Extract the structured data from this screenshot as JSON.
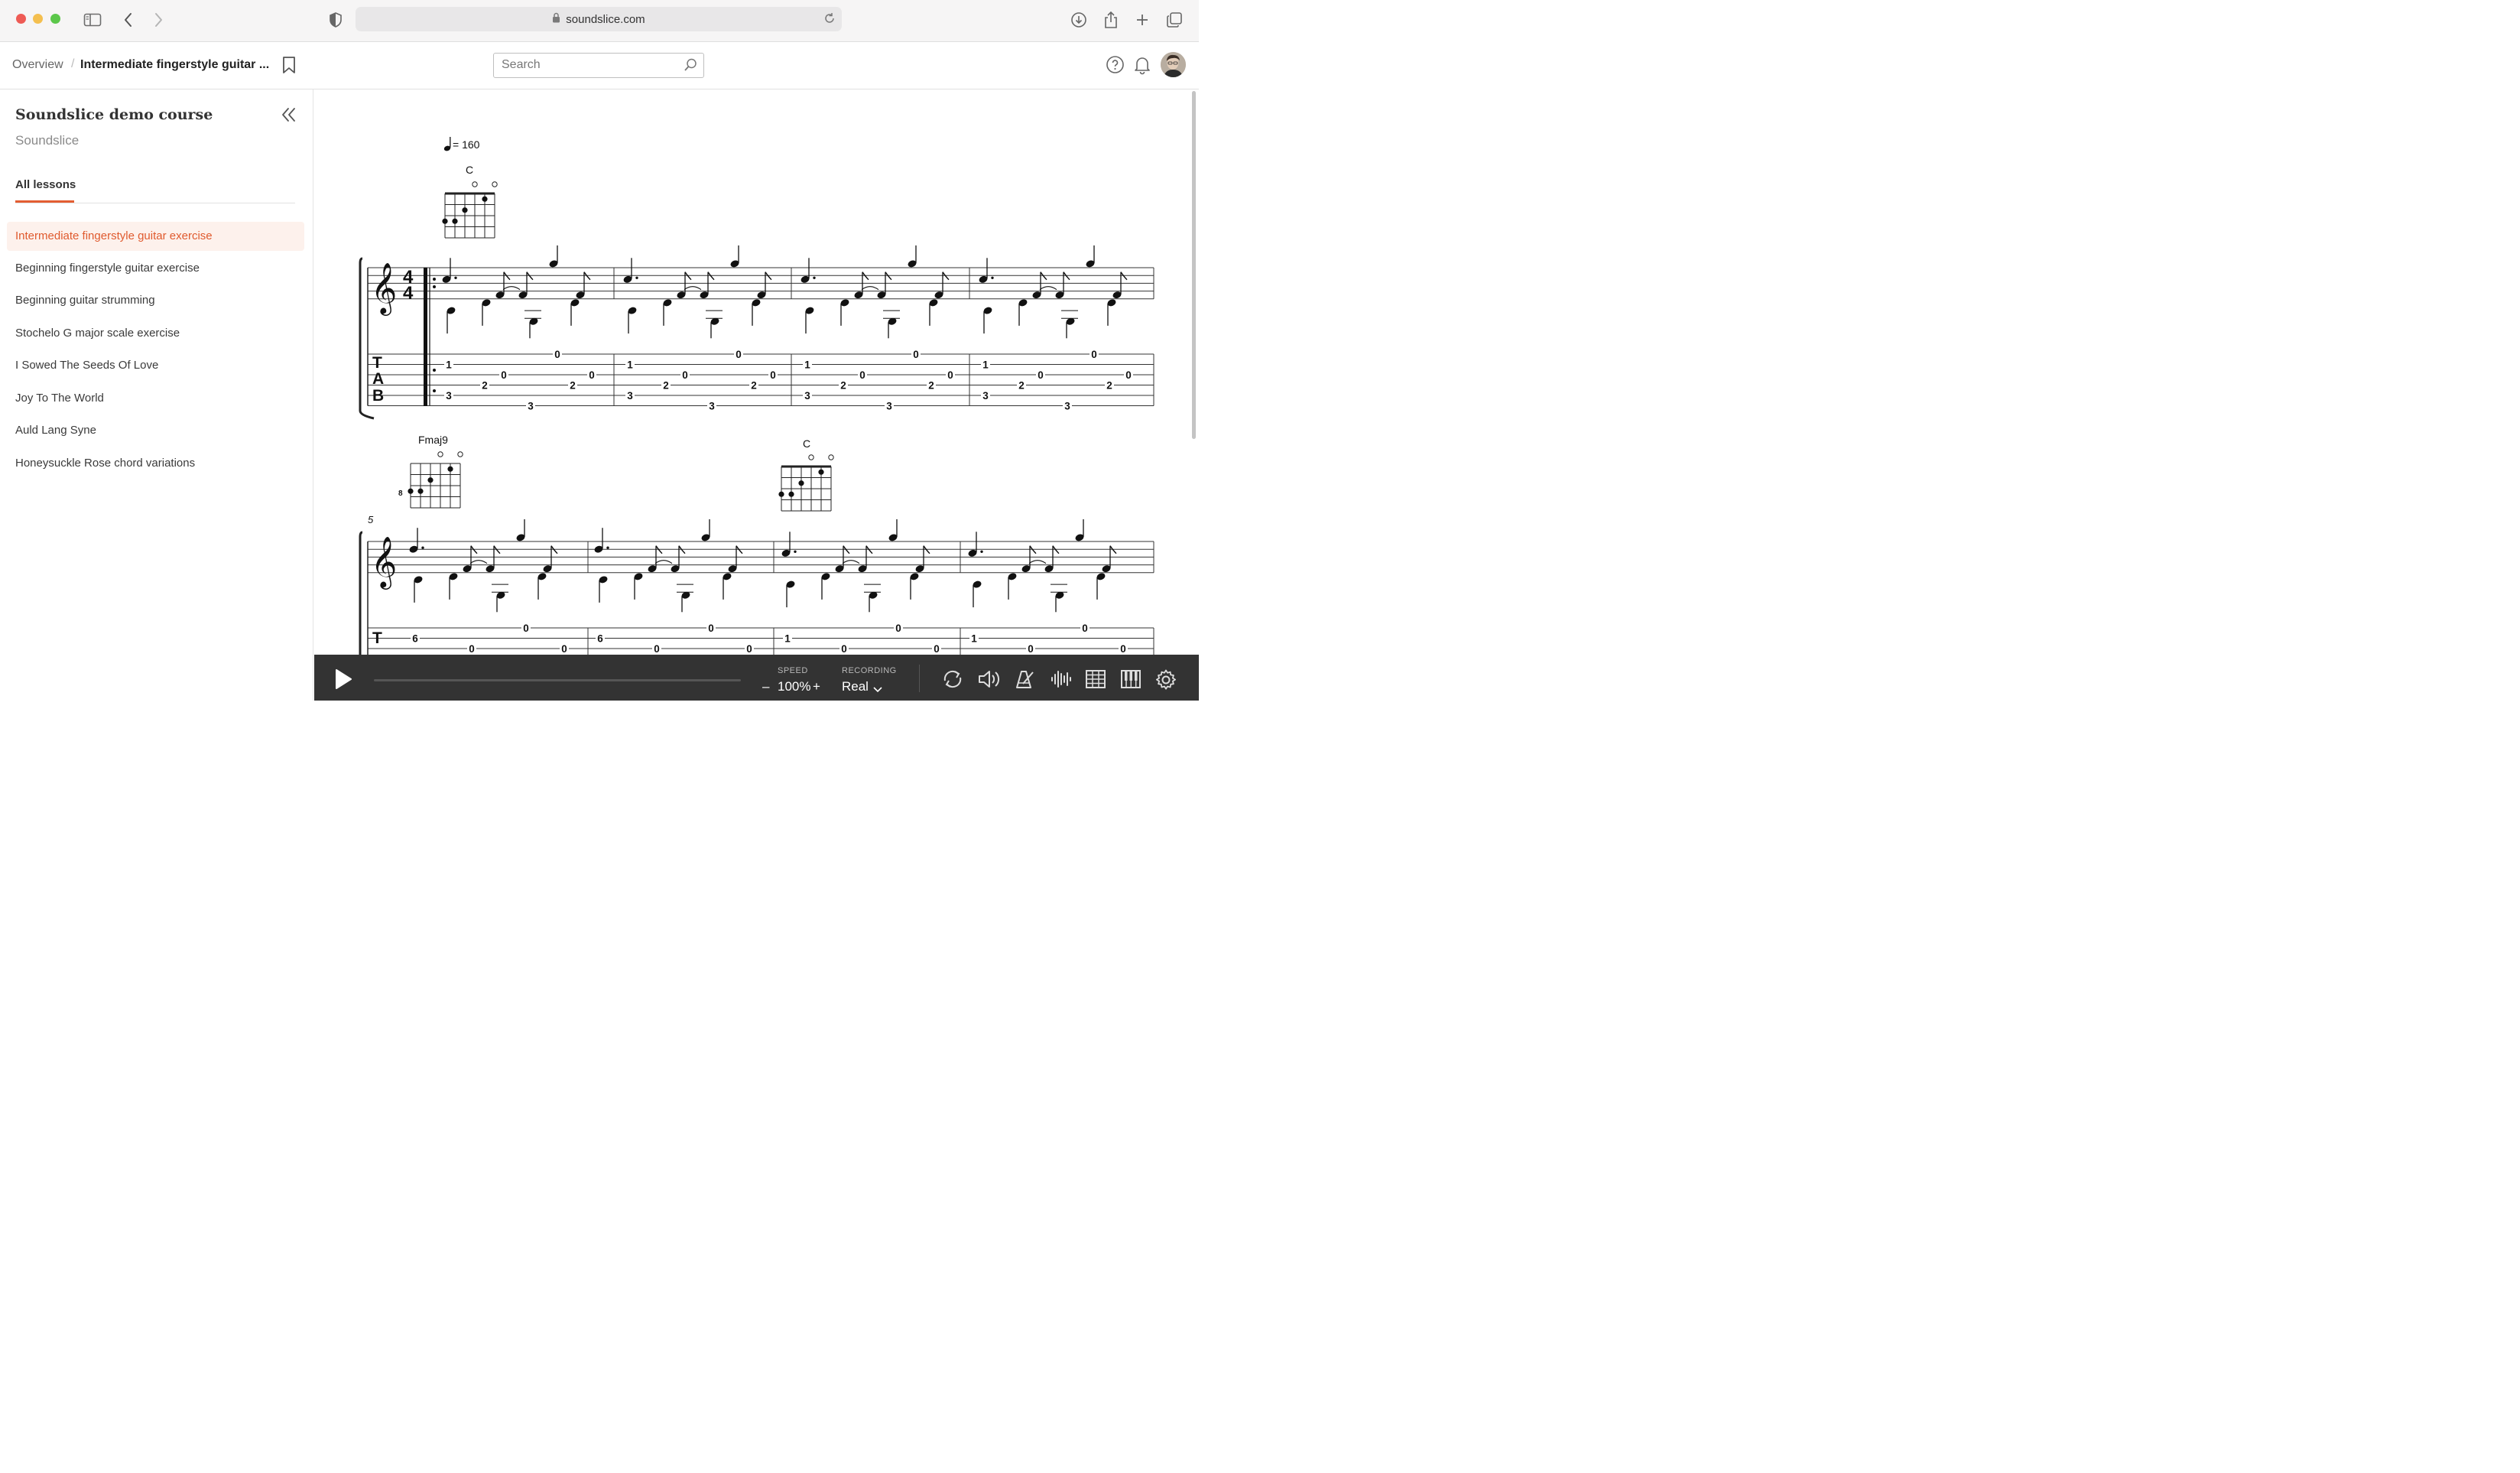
{
  "browser": {
    "url": "soundslice.com"
  },
  "header": {
    "breadcrumb_root": "Overview",
    "breadcrumb_sep": "/",
    "breadcrumb_current": "Intermediate fingerstyle guitar ...",
    "search_placeholder": "Search"
  },
  "sidebar": {
    "course_title": "Soundslice demo course",
    "course_author": "Soundslice",
    "tab_label": "All lessons",
    "lessons": [
      {
        "label": "Intermediate fingerstyle guitar exercise",
        "active": true
      },
      {
        "label": "Beginning fingerstyle guitar exercise",
        "active": false
      },
      {
        "label": "Beginning guitar strumming",
        "active": false
      },
      {
        "label": "Stochelo G major scale exercise",
        "active": false
      },
      {
        "label": "I Sowed The Seeds Of Love",
        "active": false
      },
      {
        "label": "Joy To The World",
        "active": false
      },
      {
        "label": "Auld Lang Syne",
        "active": false
      },
      {
        "label": "Honeysuckle Rose chord variations",
        "active": false
      }
    ]
  },
  "score": {
    "tempo_text": "= 160",
    "measure_number_line2": "5",
    "chords": [
      "C",
      "Fmaj9",
      "C"
    ],
    "fmaj9_fret": "8",
    "tab_clef": [
      "T",
      "A",
      "B"
    ],
    "time_signature": [
      "4",
      "4"
    ],
    "line1_tab": [
      {
        "string": 1,
        "fret": "0"
      },
      {
        "string": 2,
        "fret": "1"
      },
      {
        "string": 3,
        "fret": "0"
      },
      {
        "string": 4,
        "fret": "2"
      },
      {
        "string": 5,
        "fret": "3"
      },
      {
        "string": 6,
        "fret": "3"
      }
    ],
    "line2_tab_frets": [
      "6",
      "0",
      "0",
      "0",
      "1"
    ]
  },
  "player": {
    "speed_label": "SPEED",
    "speed_minus": "–",
    "speed_value": "100%",
    "speed_plus": "+",
    "recording_label": "RECORDING",
    "recording_value": "Real"
  },
  "icons": {
    "close": "close-dot-icon",
    "minimize": "minimize-dot-icon",
    "zoom": "zoom-dot-icon",
    "sidebar": "sidebar-toggle-icon",
    "back": "chevron-left-icon",
    "forward": "chevron-right-icon",
    "shield": "privacy-shield-icon",
    "lock": "lock-icon",
    "reload": "reload-icon",
    "download": "download-icon",
    "share": "share-icon",
    "new_tab": "plus-icon",
    "tabs": "tabs-overview-icon",
    "bookmark": "bookmark-icon",
    "search": "search-icon",
    "help": "help-icon",
    "bell": "bell-icon",
    "collapse": "double-chevron-left-icon",
    "play": "play-icon",
    "loop": "loop-icon",
    "volume": "volume-icon",
    "metronome": "metronome-icon",
    "waveform": "waveform-icon",
    "tab_view": "grid-icon",
    "piano": "piano-icon",
    "settings": "gear-icon"
  },
  "colors": {
    "accent": "#e35d32",
    "active_bg": "#fdf1ec",
    "player_bg": "#333333"
  }
}
